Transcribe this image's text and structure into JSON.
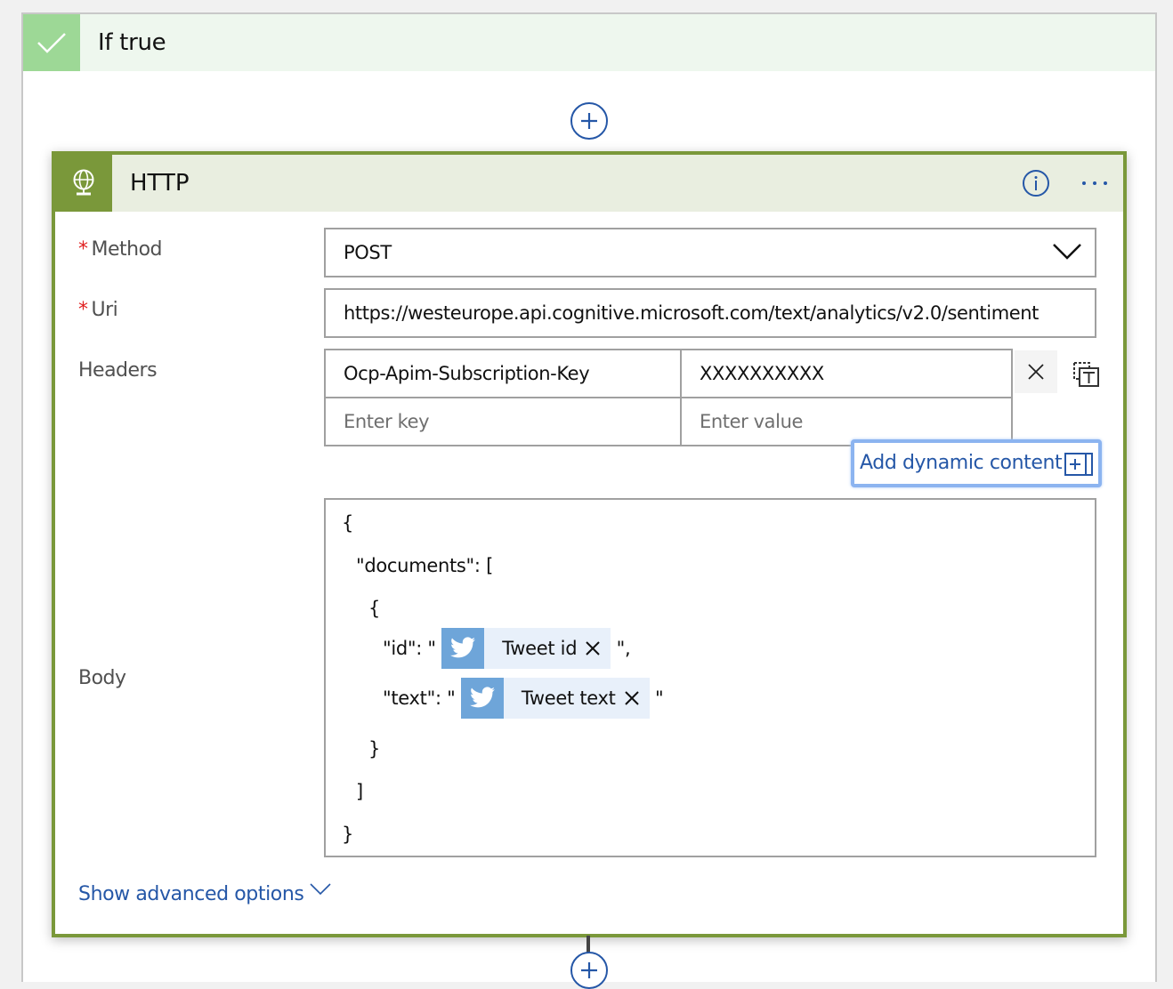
{
  "scope": {
    "title": "If true",
    "icon": "checkmark-icon",
    "header_color": "#eef7ee",
    "icon_bg_color": "#9dd896"
  },
  "action": {
    "title": "HTTP",
    "icon": "globe-icon",
    "accent_color": "#7a983a",
    "header_color": "#e9eee0",
    "info_icon": "info-icon",
    "more_icon": "ellipsis-icon"
  },
  "fields": {
    "method": {
      "label": "Method",
      "required_mark": "*",
      "value": "POST"
    },
    "uri": {
      "label": "Uri",
      "required_mark": "*",
      "value": "https://westeurope.api.cognitive.microsoft.com/text/analytics/v2.0/sentiment"
    },
    "headers": {
      "label": "Headers",
      "rows": [
        {
          "key": "Ocp-Apim-Subscription-Key",
          "value": "XXXXXXXXXX"
        }
      ],
      "key_placeholder": "Enter key",
      "value_placeholder": "Enter value"
    },
    "body": {
      "label": "Body",
      "lines": {
        "l1": "{",
        "l2": "\"documents\": [",
        "l3": "{",
        "id_prefix": "\"id\": \"",
        "id_suffix": "\",",
        "text_prefix": "\"text\": \"",
        "text_suffix": "\"",
        "l7": "}",
        "l8": "]",
        "l9": "}"
      },
      "tokens": [
        {
          "label": "Tweet id",
          "icon": "twitter-icon"
        },
        {
          "label": "Tweet text",
          "icon": "twitter-icon"
        }
      ]
    }
  },
  "dynamic_content": {
    "label": "Add dynamic content"
  },
  "advanced": {
    "label": "Show advanced options"
  },
  "link_color": "#2557a7"
}
